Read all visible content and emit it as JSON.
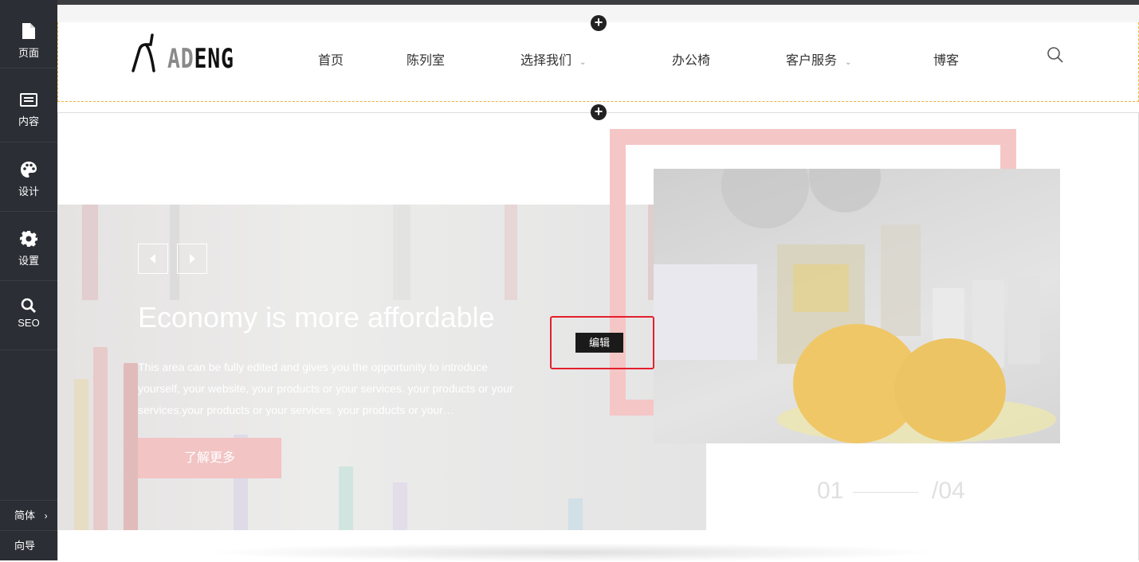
{
  "sidebar": {
    "items": [
      {
        "label": "页面",
        "icon": "page-icon"
      },
      {
        "label": "内容",
        "icon": "content-icon"
      },
      {
        "label": "设计",
        "icon": "palette-icon"
      },
      {
        "label": "设置",
        "icon": "gear-icon"
      },
      {
        "label": "SEO",
        "icon": "search-icon"
      }
    ],
    "language": "简体",
    "guide": "向导"
  },
  "header": {
    "logo_prefix": "AD",
    "logo_suffix": "ENG",
    "nav": [
      {
        "label": "首页",
        "has_dropdown": false
      },
      {
        "label": "陈列室",
        "has_dropdown": false
      },
      {
        "label": "选择我们",
        "has_dropdown": true
      },
      {
        "label": "办公椅",
        "has_dropdown": false
      },
      {
        "label": "客户服务",
        "has_dropdown": true
      },
      {
        "label": "博客",
        "has_dropdown": false
      }
    ]
  },
  "hero": {
    "title": "Economy is more affordable",
    "description": "This area can be fully edited and gives you the opportunity to introduce yourself, your website, your products or your services. your products or your services.your products or your services. your products or your…",
    "cta_label": "了解更多",
    "edit_label": "编辑",
    "counter_current": "01",
    "counter_total": "/04"
  },
  "colors": {
    "sidebar_bg": "#2b2e34",
    "accent_pink": "#f5c6c6",
    "edit_outline": "#e41f2b",
    "header_dashed": "#e8b73a"
  }
}
